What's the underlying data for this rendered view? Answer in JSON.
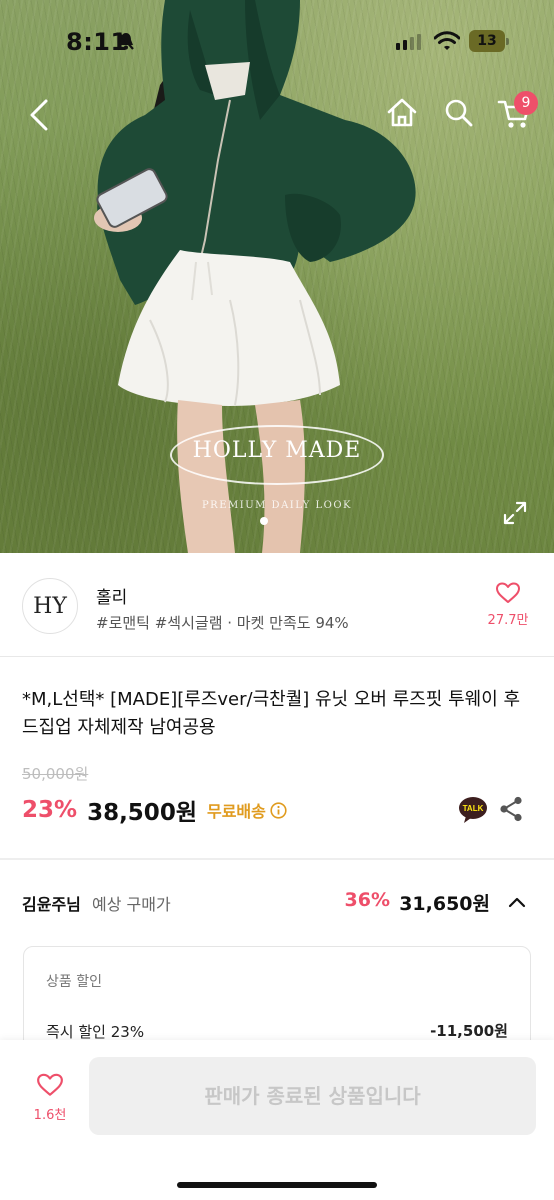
{
  "status_bar": {
    "time": "8:11",
    "battery": "13"
  },
  "nav": {
    "back_icon": "chevron-left-icon",
    "home_icon": "home-icon",
    "search_icon": "search-icon",
    "cart_icon": "cart-icon",
    "cart_count": "9"
  },
  "hero": {
    "watermark_name": "HOLLY MADE",
    "watermark_sub": "PREMIUM DAILY LOOK",
    "image_count": 1,
    "current_image": 1
  },
  "shop": {
    "logo": "HY",
    "name": "홀리",
    "tags": "#로맨틱 #섹시글램 · 마켓 만족도 94%",
    "like_count": "27.7만"
  },
  "product": {
    "title": "*M,L선택* [MADE][루즈ver/극찬퀄] 유닛 오버 루즈핏 투웨이 후드집업 자체제작 남여공용",
    "original_price": "50,000원",
    "discount": "23%",
    "price": "38,500원",
    "shipping": "무료배송"
  },
  "expected": {
    "user": "김윤주님",
    "label": "예상 구매가",
    "discount": "36%",
    "price": "31,650원",
    "box_title": "상품 할인",
    "item_label": "즉시 할인 23%",
    "item_value": "-11,500원"
  },
  "bottom": {
    "like_count": "1.6천",
    "status_button": "판매가 종료된 상품입니다"
  },
  "colors": {
    "accent": "#ee4f6a",
    "shipping": "#e09b1e",
    "disabled_bg": "#efefef",
    "disabled_text": "#c7c7c7"
  }
}
